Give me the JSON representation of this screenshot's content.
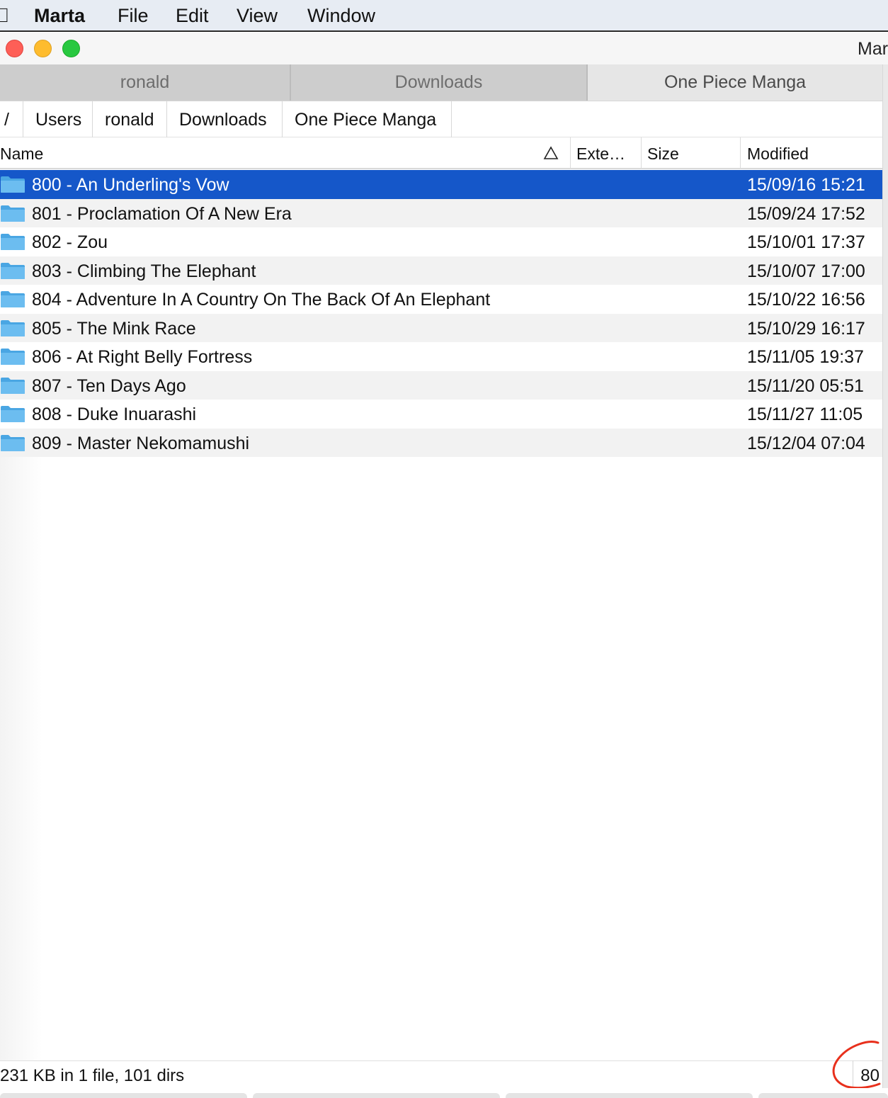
{
  "menubar": {
    "app": "Marta",
    "items": [
      "File",
      "Edit",
      "View",
      "Window"
    ]
  },
  "window": {
    "title": "Mar",
    "traffic_lights": {
      "close": "#fe5f57",
      "minimize": "#febc2e",
      "zoom": "#28c840"
    }
  },
  "tabs": [
    {
      "label": "ronald",
      "active": false
    },
    {
      "label": "Downloads",
      "active": false
    },
    {
      "label": "One Piece Manga",
      "active": true
    }
  ],
  "breadcrumb": [
    "/",
    "Users",
    "ronald",
    "Downloads",
    "One Piece Manga"
  ],
  "columns": {
    "name": "Name",
    "extension": "Exte…",
    "size": "Size",
    "modified": "Modified",
    "sort_icon": "sort-ascending-triangle-icon"
  },
  "rows": [
    {
      "name": "800 - An Underling's Vow",
      "modified": "15/09/16 15:21",
      "selected": true
    },
    {
      "name": "801 - Proclamation Of A New Era",
      "modified": "15/09/24 17:52",
      "selected": false
    },
    {
      "name": "802 - Zou",
      "modified": "15/10/01 17:37",
      "selected": false
    },
    {
      "name": "803 - Climbing The Elephant",
      "modified": "15/10/07 17:00",
      "selected": false
    },
    {
      "name": "804 - Adventure In A Country On The Back Of An Elephant",
      "modified": "15/10/22 16:56",
      "selected": false
    },
    {
      "name": "805 - The Mink Race",
      "modified": "15/10/29 16:17",
      "selected": false
    },
    {
      "name": "806 - At Right Belly Fortress",
      "modified": "15/11/05 19:37",
      "selected": false
    },
    {
      "name": "807 - Ten Days Ago",
      "modified": "15/11/20 05:51",
      "selected": false
    },
    {
      "name": "808 - Duke Inuarashi",
      "modified": "15/11/27 11:05",
      "selected": false
    },
    {
      "name": "809 - Master Nekomamushi",
      "modified": "15/12/04 07:04",
      "selected": false
    }
  ],
  "status": {
    "summary": "231 KB in 1 file, 101 dirs",
    "count": "80"
  },
  "colors": {
    "selection": "#1557c9",
    "folder": "#5fb4ea",
    "annotation": "#e8301c"
  }
}
